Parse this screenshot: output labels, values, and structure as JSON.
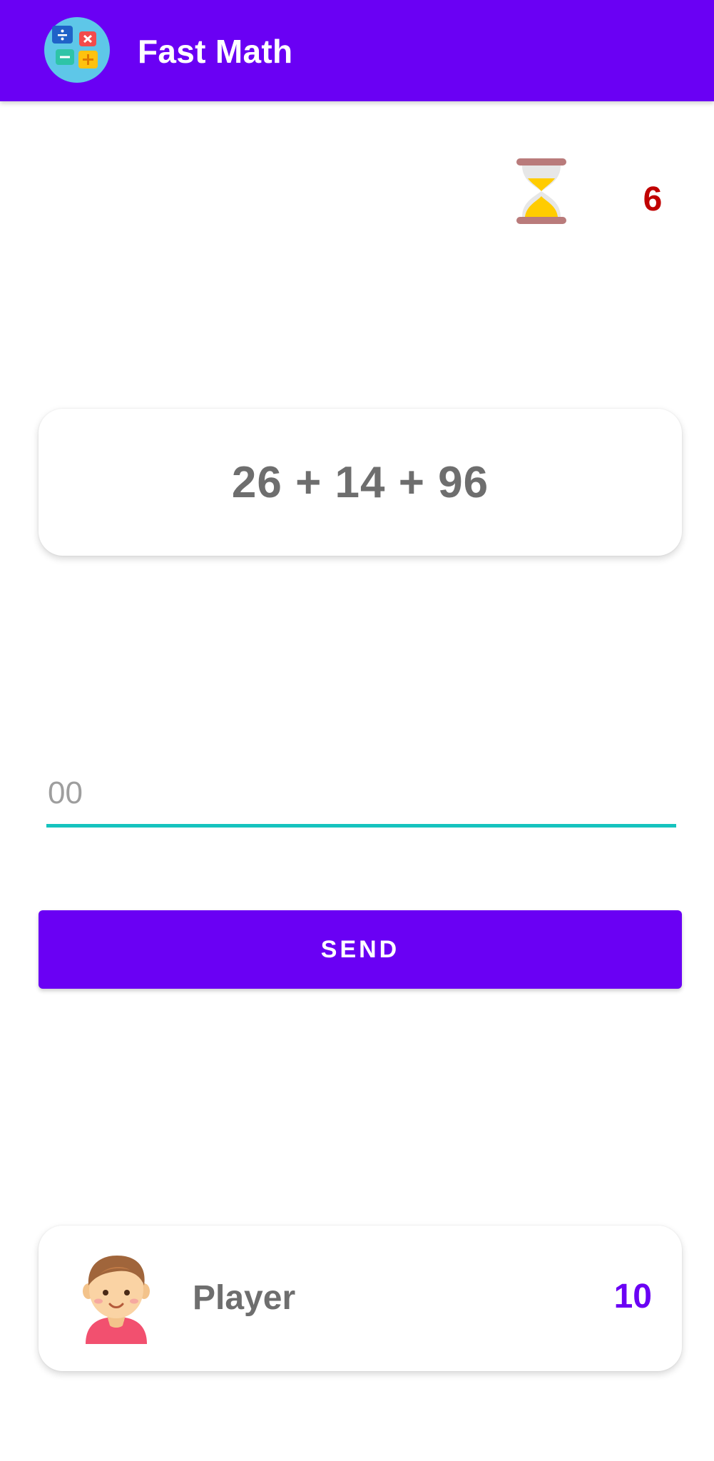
{
  "app": {
    "title": "Fast Math",
    "logo_icon": "calculator-operations-icon"
  },
  "timer": {
    "icon": "hourglass-icon",
    "value": "6"
  },
  "question": {
    "expression": "26  +  14  +  96"
  },
  "answer": {
    "placeholder": "00",
    "value": ""
  },
  "send_button": {
    "label": "SEND"
  },
  "player": {
    "avatar_icon": "boy-avatar-icon",
    "name": "Player",
    "score": "10"
  },
  "colors": {
    "primary": "#6a00f4",
    "accent": "#16c3be",
    "timer": "#c00000",
    "text_gray": "#6e6e6e"
  }
}
